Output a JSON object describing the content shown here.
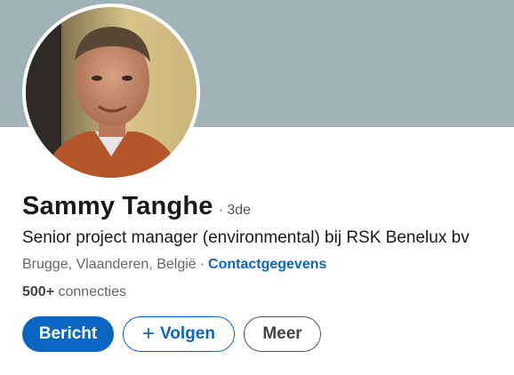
{
  "profile": {
    "name": "Sammy Tanghe",
    "degree": "· 3de",
    "headline": "Senior project manager (environmental) bij RSK Benelux bv",
    "location": "Brugge, Vlaanderen, België",
    "separator": "·",
    "contact_link": "Contactgegevens",
    "connections_count": "500+",
    "connections_label": "connecties"
  },
  "actions": {
    "message_label": "Bericht",
    "follow_plus": "+",
    "follow_label": "Volgen",
    "more_label": "Meer"
  },
  "colors": {
    "banner": "#a0b4b7",
    "accent": "#0a66c2"
  }
}
